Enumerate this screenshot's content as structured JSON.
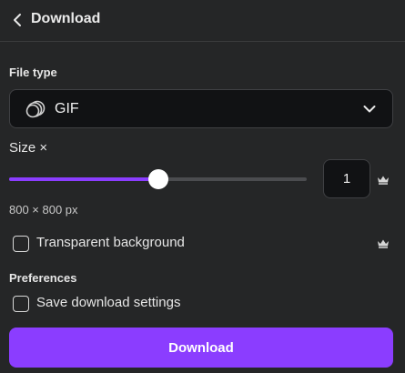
{
  "header": {
    "title": "Download",
    "back_icon": "chevron-left-icon"
  },
  "file_type": {
    "label": "File type",
    "selected": "GIF",
    "icon": "gif-file-icon",
    "dropdown_icon": "chevron-down-icon"
  },
  "size": {
    "label": "Size ×",
    "slider_fraction": 0.5,
    "value": "1",
    "dimensions": "800 × 800 px",
    "premium_icon": "crown-icon"
  },
  "transparent_background": {
    "label": "Transparent background",
    "checked": false,
    "premium_icon": "crown-icon"
  },
  "preferences": {
    "label": "Preferences",
    "save_settings": {
      "label": "Save download settings",
      "checked": false
    }
  },
  "actions": {
    "download_label": "Download"
  },
  "colors": {
    "accent": "#8b3dff",
    "background": "#252627",
    "field_background": "#111214"
  }
}
